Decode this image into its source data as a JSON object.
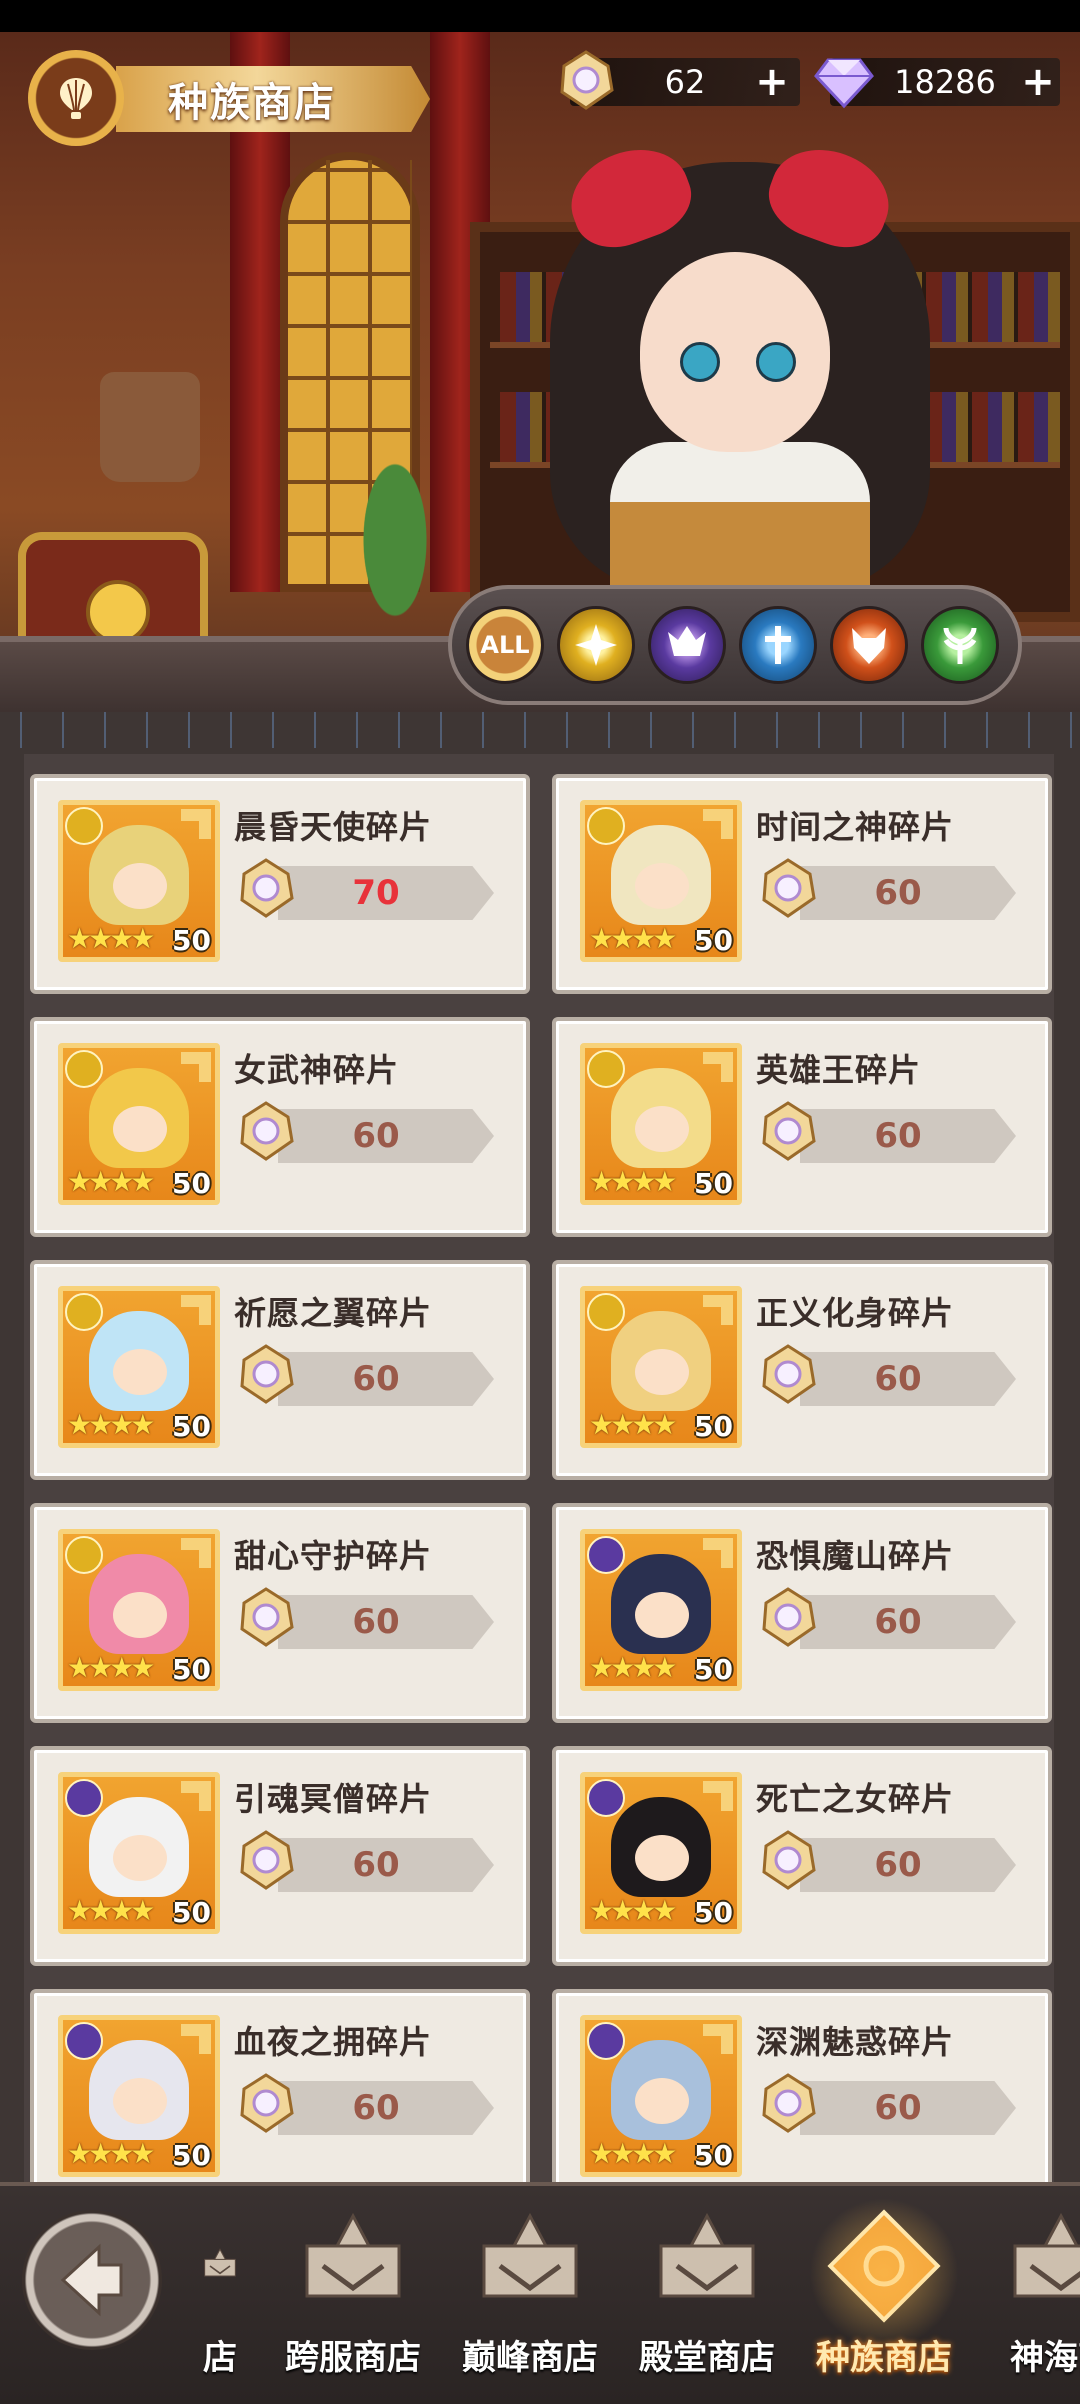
{
  "header": {
    "title": "种族商店"
  },
  "resources": [
    {
      "icon": "token-icon",
      "value": "62"
    },
    {
      "icon": "diamond-icon",
      "value": "18286"
    }
  ],
  "filters": [
    {
      "name": "all",
      "label": "ALL",
      "color": "#c9843a"
    },
    {
      "name": "light",
      "label": "",
      "color": "#e0b020"
    },
    {
      "name": "dark",
      "label": "",
      "color": "#5a3aa0"
    },
    {
      "name": "human",
      "label": "",
      "color": "#2a7ac0"
    },
    {
      "name": "beast",
      "label": "",
      "color": "#d0501a"
    },
    {
      "name": "nature",
      "label": "",
      "color": "#3a9a3a"
    }
  ],
  "items": [
    {
      "name": "晨昏天使碎片",
      "price": "70",
      "stars": "★★★★",
      "count": "50",
      "faction": "light",
      "hair": "#e8d27a",
      "highlight": true
    },
    {
      "name": "时间之神碎片",
      "price": "60",
      "stars": "★★★★",
      "count": "50",
      "faction": "light",
      "hair": "#f0e6c0",
      "highlight": false
    },
    {
      "name": "女武神碎片",
      "price": "60",
      "stars": "★★★★",
      "count": "50",
      "faction": "light",
      "hair": "#f2c84a",
      "highlight": false
    },
    {
      "name": "英雄王碎片",
      "price": "60",
      "stars": "★★★★",
      "count": "50",
      "faction": "light",
      "hair": "#f3dc8a",
      "highlight": false
    },
    {
      "name": "祈愿之翼碎片",
      "price": "60",
      "stars": "★★★★",
      "count": "50",
      "faction": "light",
      "hair": "#bfe4f6",
      "highlight": false
    },
    {
      "name": "正义化身碎片",
      "price": "60",
      "stars": "★★★★",
      "count": "50",
      "faction": "light",
      "hair": "#f0d080",
      "highlight": false
    },
    {
      "name": "甜心守护碎片",
      "price": "60",
      "stars": "★★★★",
      "count": "50",
      "faction": "light",
      "hair": "#f08aa8",
      "highlight": false
    },
    {
      "name": "恐惧魔山碎片",
      "price": "60",
      "stars": "★★★★",
      "count": "50",
      "faction": "dark",
      "hair": "#2a3050",
      "highlight": false
    },
    {
      "name": "引魂冥僧碎片",
      "price": "60",
      "stars": "★★★★",
      "count": "50",
      "faction": "dark",
      "hair": "#f2f2f2",
      "highlight": false
    },
    {
      "name": "死亡之女碎片",
      "price": "60",
      "stars": "★★★★",
      "count": "50",
      "faction": "dark",
      "hair": "#1e1a1c",
      "highlight": false
    },
    {
      "name": "血夜之拥碎片",
      "price": "60",
      "stars": "★★★★",
      "count": "50",
      "faction": "dark",
      "hair": "#e6e6ee",
      "highlight": false
    },
    {
      "name": "深渊魅惑碎片",
      "price": "60",
      "stars": "★★★★",
      "count": "50",
      "faction": "dark",
      "hair": "#a8c0dc",
      "highlight": false
    }
  ],
  "nav": {
    "tabs": [
      {
        "label": "店",
        "active": false
      },
      {
        "label": "跨服商店",
        "active": false
      },
      {
        "label": "巅峰商店",
        "active": false
      },
      {
        "label": "殿堂商店",
        "active": false
      },
      {
        "label": "种族商店",
        "active": true
      },
      {
        "label": "神海商",
        "active": false
      }
    ]
  },
  "colors": {
    "accent": "#f3c84a",
    "price_highlight": "#e8323a",
    "price": "#9a5a4a"
  }
}
